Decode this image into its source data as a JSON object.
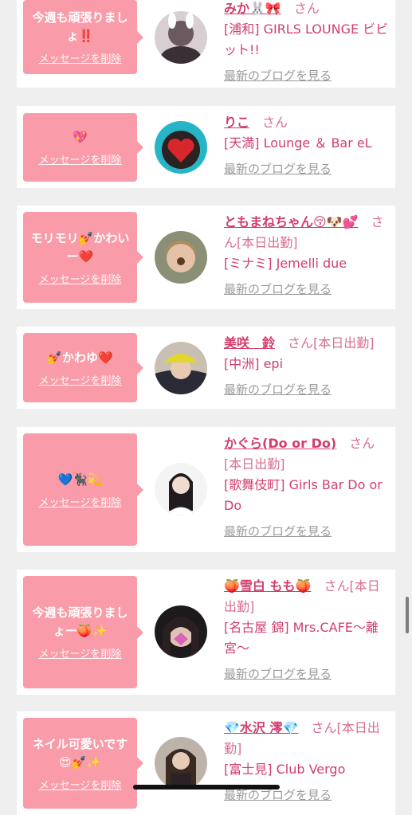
{
  "common": {
    "delete_label": "メッセージを削除",
    "blog_label": "最新のブログを見る",
    "san": "さん"
  },
  "cards": [
    {
      "message": "今週も頑張りましょ‼️",
      "name": "みか🐰🎀",
      "status": "",
      "shop": "[浦和] GIRLS LOUNGE ビビット!!"
    },
    {
      "message": "💖",
      "name": "りこ",
      "status": "",
      "shop": "[天満] Lounge ＆ Bar eL"
    },
    {
      "message": "モリモリ💅かわいー❤️",
      "name": "ともまねちゃん😚🐶💕",
      "status": "[本日出勤]",
      "shop": "[ミナミ] Jemelli due"
    },
    {
      "message": "💅かわゆ❤️",
      "name": "美咲　鈴",
      "status": "[本日出勤]",
      "shop": "[中洲] epi"
    },
    {
      "message": "💙🐈‍⬛💫",
      "name": "かぐら(Do or Do)",
      "status": "[本日出勤]",
      "shop": "[歌舞伎町] Girls Bar Do or Do"
    },
    {
      "message": "今週も頑張りましょー🍑✨",
      "name": "🍑雪白 もも🍑",
      "status": "[本日出勤]",
      "shop": "[名古屋 錦] Mrs.CAFE〜離宮〜"
    },
    {
      "message": "ネイル可愛いです😍💅✨",
      "name": "💎水沢 澪💎",
      "status": "[本日出勤]",
      "shop": "[富士見] Club Vergo"
    }
  ]
}
